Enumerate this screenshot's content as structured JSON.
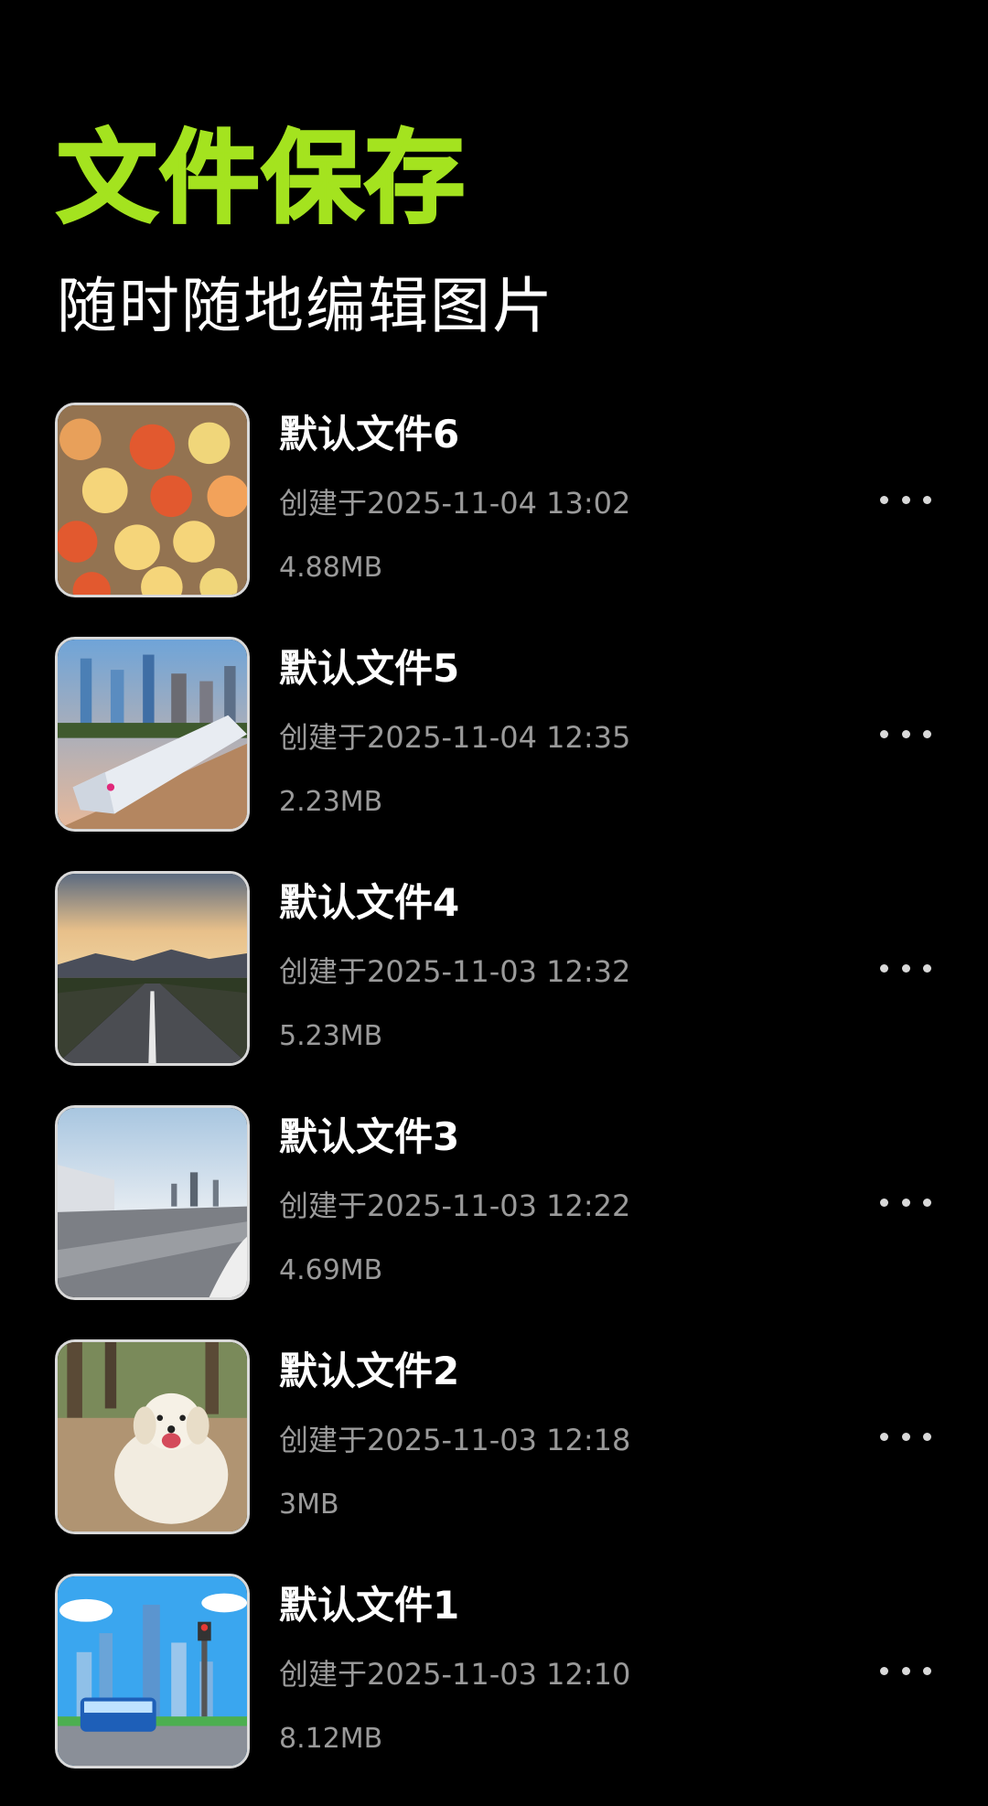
{
  "header": {
    "title": "文件保存",
    "subtitle": "随时随地编辑图片"
  },
  "files": [
    {
      "name": "默认文件6",
      "created": "创建于2025-11-04 13:02",
      "size": "4.88MB",
      "thumb": "buttons-image"
    },
    {
      "name": "默认文件5",
      "created": "创建于2025-11-04 12:35",
      "size": "2.23MB",
      "thumb": "train-city-image"
    },
    {
      "name": "默认文件4",
      "created": "创建于2025-11-03 12:32",
      "size": "5.23MB",
      "thumb": "road-sunset-image"
    },
    {
      "name": "默认文件3",
      "created": "创建于2025-11-03 12:22",
      "size": "4.69MB",
      "thumb": "racetrack-image"
    },
    {
      "name": "默认文件2",
      "created": "创建于2025-11-03 12:18",
      "size": "3MB",
      "thumb": "dog-image"
    },
    {
      "name": "默认文件1",
      "created": "创建于2025-11-03 12:10",
      "size": "8.12MB",
      "thumb": "bus-city-image"
    }
  ],
  "colors": {
    "accent": "#a4e31f",
    "background": "#000000",
    "secondary_text": "#9a9a9a"
  }
}
